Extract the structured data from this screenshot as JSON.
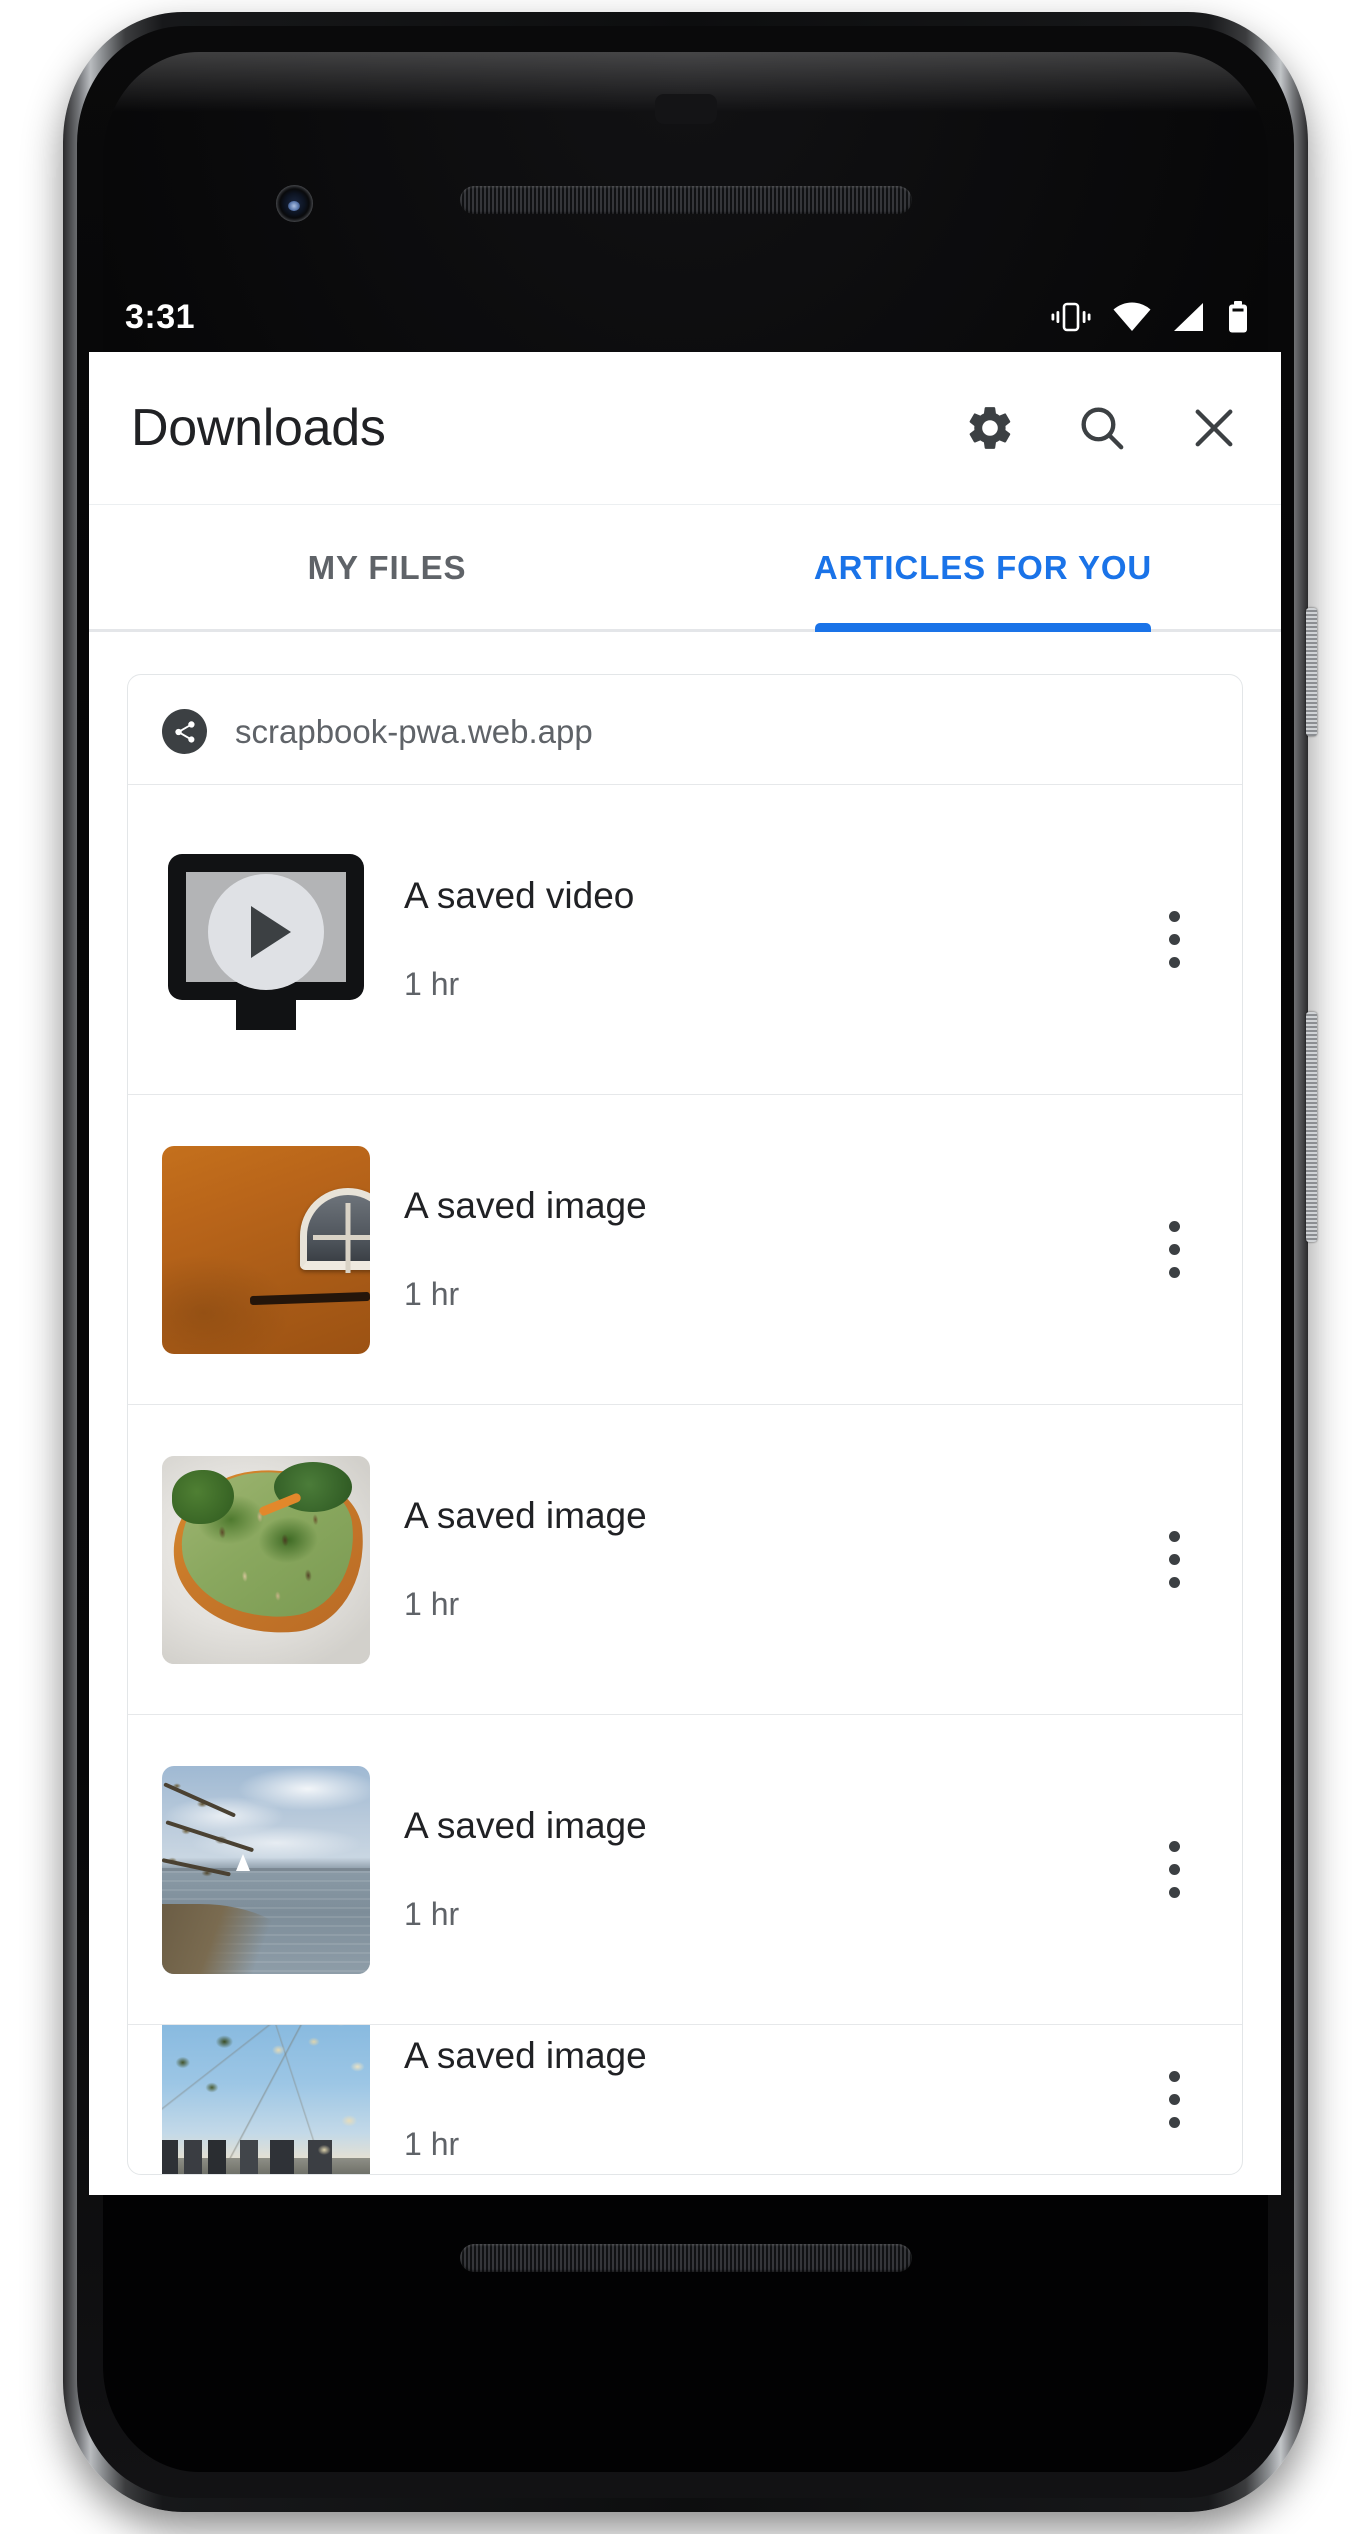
{
  "status_bar": {
    "clock": "3:31",
    "icons": [
      "vibrate-icon",
      "wifi-icon",
      "cell-signal-icon",
      "battery-icon"
    ]
  },
  "toolbar": {
    "title": "Downloads",
    "actions": [
      {
        "name": "settings-button",
        "icon": "gear-icon"
      },
      {
        "name": "search-button",
        "icon": "search-icon"
      },
      {
        "name": "close-button",
        "icon": "close-icon"
      }
    ]
  },
  "tabs": {
    "items": [
      {
        "label": "MY FILES",
        "active": false
      },
      {
        "label": "ARTICLES FOR YOU",
        "active": true
      }
    ],
    "active_color": "#1a73e8",
    "inactive_color": "#5f6368"
  },
  "card": {
    "source_icon": "share-icon",
    "domain": "scrapbook-pwa.web.app",
    "rows": [
      {
        "title": "A saved video",
        "time": "1 hr",
        "thumb": "video-placeholder-thumbnail",
        "menu_icon": "more-vert-icon"
      },
      {
        "title": "A saved image",
        "time": "1 hr",
        "thumb": "orange-wall-arched-window-photo",
        "menu_icon": "more-vert-icon"
      },
      {
        "title": "A saved image",
        "time": "1 hr",
        "thumb": "avocado-toast-food-photo",
        "menu_icon": "more-vert-icon"
      },
      {
        "title": "A saved image",
        "time": "1 hr",
        "thumb": "lakeside-sailboat-photo",
        "menu_icon": "more-vert-icon"
      },
      {
        "title": "A saved image",
        "time": "1 hr",
        "thumb": "city-skyline-blossoms-photo",
        "menu_icon": "more-vert-icon"
      }
    ]
  },
  "device": {
    "hardware": [
      "front-camera",
      "top-speaker-grille",
      "bottom-speaker-grille",
      "power-button",
      "volume-button"
    ]
  },
  "colors": {
    "accent": "#1a73e8",
    "text_primary": "#202124",
    "text_secondary": "#5f6368",
    "divider": "#e6e8ea",
    "surface": "#ffffff"
  }
}
